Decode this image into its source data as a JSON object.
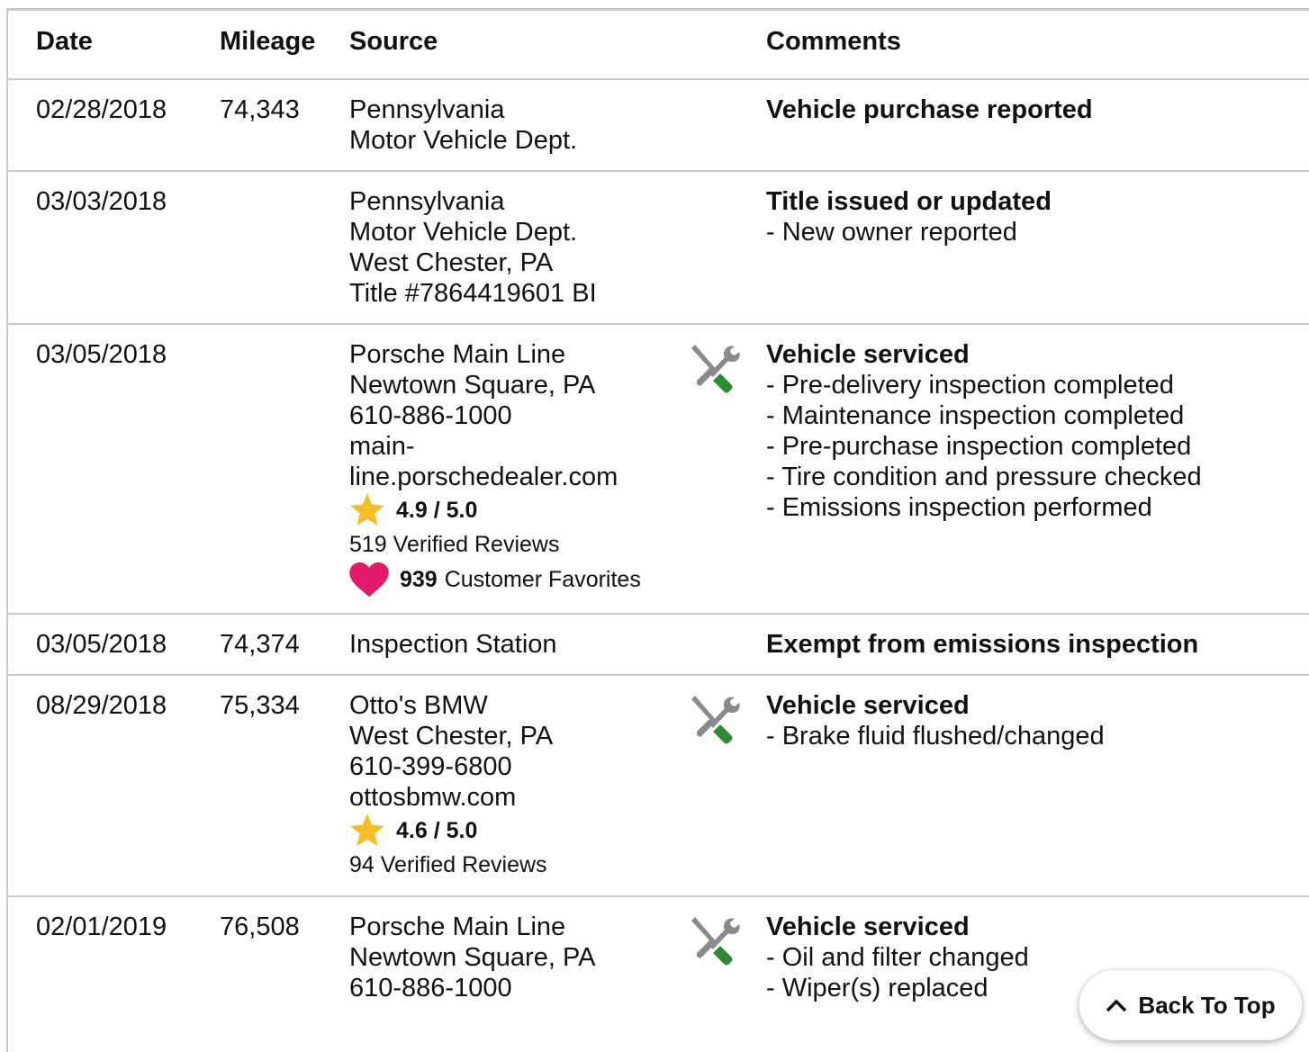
{
  "table": {
    "headers": [
      "Date",
      "Mileage",
      "Source",
      "Comments"
    ],
    "rows": [
      {
        "date": "02/28/2018",
        "mileage": "74,343",
        "source": [
          "Pennsylvania",
          "Motor Vehicle Dept."
        ],
        "comment_title": "Vehicle purchase reported",
        "comments": []
      },
      {
        "date": "03/03/2018",
        "mileage": "",
        "source": [
          "Pennsylvania",
          "Motor Vehicle Dept.",
          "West Chester, PA",
          "Title #7864419601 BI"
        ],
        "comment_title": "Title issued or updated",
        "comments": [
          "New owner reported"
        ]
      },
      {
        "date": "03/05/2018",
        "mileage": "",
        "source": [
          "Porsche Main Line",
          "Newtown Square, PA",
          "610-886-1000",
          "main-line.porschedealer.com"
        ],
        "rating": "4.9 / 5.0",
        "reviews": "519 Verified Reviews",
        "favorites_count": "939",
        "favorites_label": "Customer Favorites",
        "icon": "wrench-screwdriver-icon",
        "comment_title": "Vehicle serviced",
        "comments": [
          "Pre-delivery inspection completed",
          "Maintenance inspection completed",
          "Pre-purchase inspection completed",
          "Tire condition and pressure checked",
          "Emissions inspection performed"
        ]
      },
      {
        "date": "03/05/2018",
        "mileage": "74,374",
        "source": [
          "Inspection Station"
        ],
        "comment_title": "Exempt from emissions inspection",
        "comments": []
      },
      {
        "date": "08/29/2018",
        "mileage": "75,334",
        "source": [
          "Otto's BMW",
          "West Chester, PA",
          "610-399-6800",
          "ottosbmw.com"
        ],
        "rating": "4.6 / 5.0",
        "reviews": "94 Verified Reviews",
        "icon": "wrench-screwdriver-icon",
        "comment_title": "Vehicle serviced",
        "comments": [
          "Brake fluid flushed/changed"
        ]
      },
      {
        "date": "02/01/2019",
        "mileage": "76,508",
        "source": [
          "Porsche Main Line",
          "Newtown Square, PA",
          "610-886-1000"
        ],
        "icon": "wrench-screwdriver-icon",
        "comment_title": "Vehicle serviced",
        "comments": [
          "Oil and filter changed",
          "Wiper(s) replaced"
        ]
      }
    ]
  },
  "back_to_top": {
    "label": "Back To Top"
  },
  "colors": {
    "star": "#f6be25",
    "heart": "#e0196b",
    "wrench_grey": "#8a8a8a",
    "screwdriver_green": "#2e8b32",
    "border": "#c8c8c8"
  }
}
